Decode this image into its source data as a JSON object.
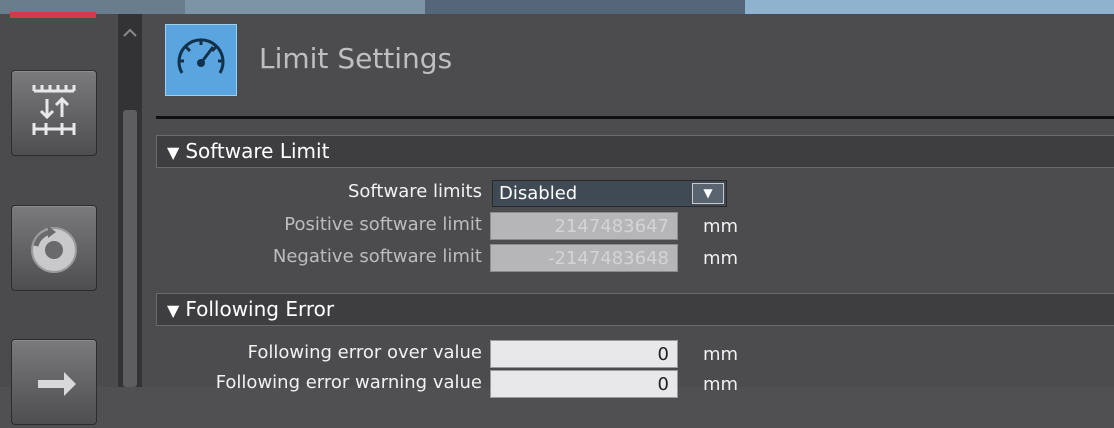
{
  "header": {
    "title": "Limit Settings",
    "icon": "speedometer-icon"
  },
  "sidebar": {
    "buttons": [
      {
        "icon": "axis-scale-icon"
      },
      {
        "icon": "homing-cycle-icon"
      },
      {
        "icon": "transfer-arrows-icon"
      }
    ]
  },
  "software_limit": {
    "heading": "Software Limit",
    "mode_label": "Software limits",
    "mode_value": "Disabled",
    "positive_label": "Positive software limit",
    "positive_value": "2147483647",
    "positive_unit": "mm",
    "negative_label": "Negative software limit",
    "negative_value": "-2147483648",
    "negative_unit": "mm"
  },
  "following_error": {
    "heading": "Following Error",
    "over_label": "Following error over value",
    "over_value": "0",
    "over_unit": "mm",
    "warning_label": "Following error warning value",
    "warning_value": "0",
    "warning_unit": "mm"
  },
  "colors": {
    "accent": "#5aa5e0",
    "panel": "#4c4c4e",
    "section_bar": "#3e3e40"
  }
}
